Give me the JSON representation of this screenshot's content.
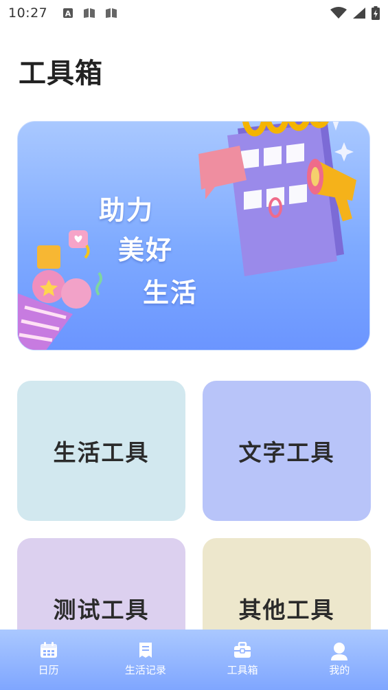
{
  "status_bar": {
    "time": "10:27"
  },
  "header": {
    "title": "工具箱"
  },
  "banner": {
    "slogan": [
      "助力",
      "美好",
      "生活"
    ]
  },
  "tools": [
    {
      "label": "生活工具",
      "color": "#d2e8ef"
    },
    {
      "label": "文字工具",
      "color": "#b8c4f9"
    },
    {
      "label": "测试工具",
      "color": "#dcd0ef"
    },
    {
      "label": "其他工具",
      "color": "#ede7cc"
    }
  ],
  "bottom_nav": {
    "items": [
      {
        "label": "日历",
        "icon": "calendar-icon"
      },
      {
        "label": "生活记录",
        "icon": "notes-icon"
      },
      {
        "label": "工具箱",
        "icon": "toolbox-icon",
        "active": true
      },
      {
        "label": "我的",
        "icon": "user-icon"
      }
    ]
  },
  "colors": {
    "accent": "#7eaaff",
    "nav_text": "#ffffff"
  }
}
